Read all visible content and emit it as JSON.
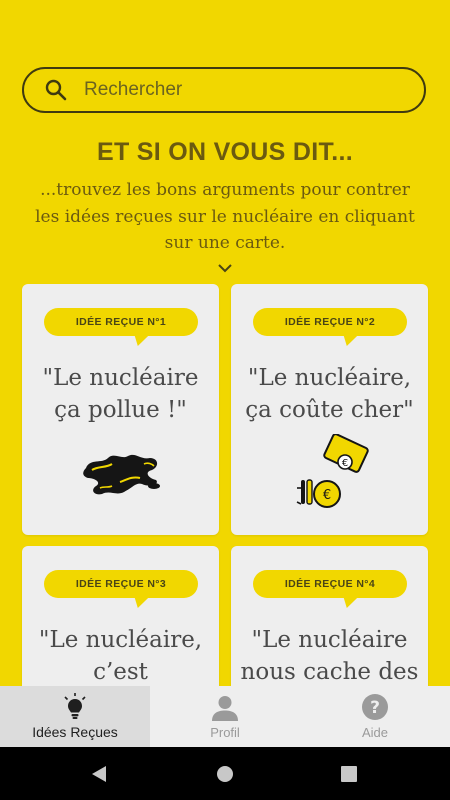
{
  "search": {
    "placeholder": "Rechercher"
  },
  "header": {
    "title": "ET SI ON VOUS DIT...",
    "subtitle": "...trouvez les bons arguments pour contrer les idées reçues sur le nucléaire en cliquant sur une carte."
  },
  "cards": [
    {
      "badge": "IDÉE REÇUE N°1",
      "quote": "\"Le nucléaire ça pollue !\"",
      "icon": "oil-spill-icon"
    },
    {
      "badge": "IDÉE REÇUE N°2",
      "quote": "\"Le nucléaire, ça coûte cher\"",
      "icon": "money-icon"
    },
    {
      "badge": "IDÉE REÇUE N°3",
      "quote": "\"Le nucléaire, c’est",
      "icon": ""
    },
    {
      "badge": "IDÉE REÇUE N°4",
      "quote": "\"Le nucléaire nous cache des",
      "icon": ""
    }
  ],
  "bottom_nav": [
    {
      "label": "Idées Reçues",
      "icon": "lightbulb-icon",
      "active": true
    },
    {
      "label": "Profil",
      "icon": "person-icon",
      "active": false
    },
    {
      "label": "Aide",
      "icon": "help-icon",
      "active": false
    }
  ],
  "colors": {
    "background": "#f1d700",
    "card": "#eeeeee",
    "text_dark": "#6b5a10"
  }
}
